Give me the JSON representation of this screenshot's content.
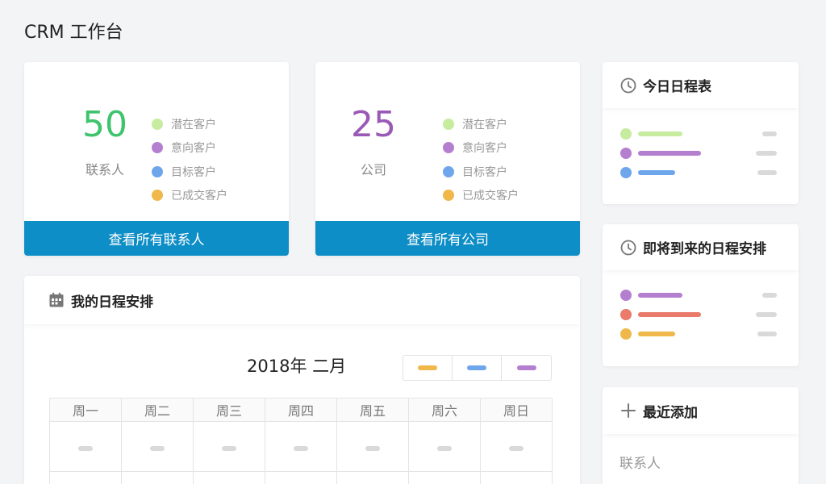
{
  "page": {
    "title": "CRM 工作台"
  },
  "contacts_card": {
    "count": "50",
    "label": "联系人",
    "button": "查看所有联系人",
    "count_color": "#3ec46d"
  },
  "companies_card": {
    "count": "25",
    "label": "公司",
    "button": "查看所有公司",
    "count_color": "#9b59b6"
  },
  "legend": [
    {
      "label": "潜在客户",
      "color": "#c8ec9f"
    },
    {
      "label": "意向客户",
      "color": "#b57fd0"
    },
    {
      "label": "目标客户",
      "color": "#6ea6ec"
    },
    {
      "label": "已成交客户",
      "color": "#f0b84a"
    }
  ],
  "today_schedule": {
    "title": "今日日程表",
    "icon": "clock-icon",
    "colors": [
      "#c8ec9f",
      "#b57fd0",
      "#6ea6ec"
    ]
  },
  "upcoming_schedule": {
    "title": "即将到来的日程安排",
    "icon": "clock-icon",
    "colors": [
      "#b57fd0",
      "#ea7a6a",
      "#f0b84a"
    ]
  },
  "recent": {
    "title": "最近添加",
    "icon": "plus-icon",
    "item": "联系人"
  },
  "my_schedule": {
    "title": "我的日程安排",
    "icon": "calendar-icon",
    "month": "2018年 二月",
    "filter_colors": [
      "#f0b84a",
      "#6ea6ec",
      "#b57fd0"
    ],
    "weekdays": [
      "周一",
      "周二",
      "周三",
      "周四",
      "周五",
      "周六",
      "周日"
    ]
  }
}
